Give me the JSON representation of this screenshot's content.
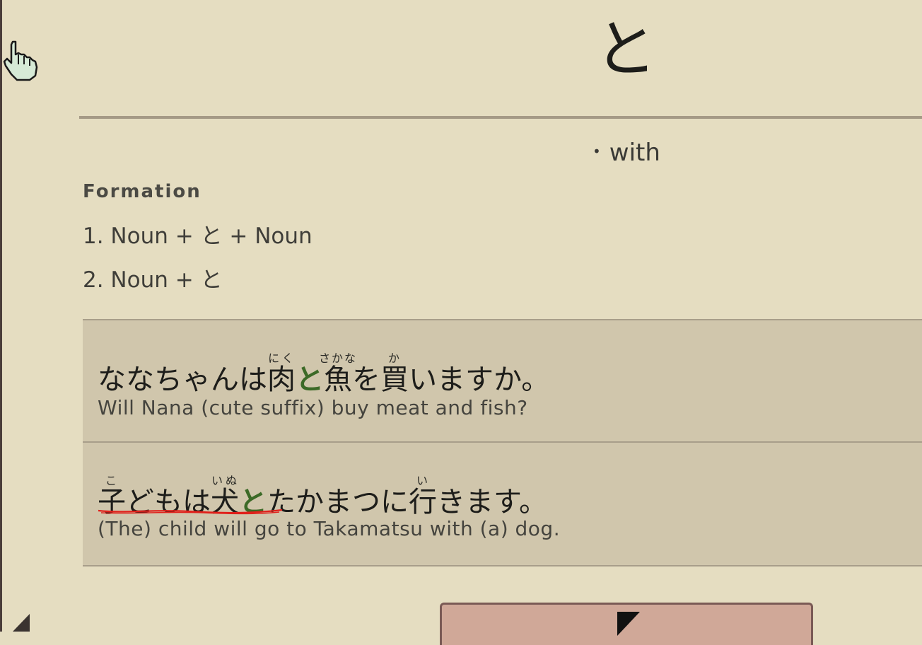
{
  "grammar": {
    "title": "と",
    "meaning": "with"
  },
  "formation": {
    "heading": "Formation",
    "items": [
      "1. Noun + と + Noun",
      "2. Noun + と"
    ]
  },
  "examples": [
    {
      "jp": {
        "pre": "ななちゃんは",
        "k1": "肉",
        "k1_ruby": "にく",
        "particle": "と",
        "k2": "魚",
        "k2_ruby": "さかな",
        "mid": "を",
        "k3": "買",
        "k3_ruby": "か",
        "post": "いますか。"
      },
      "en": "Will Nana (cute suffix) buy meat and fish?"
    },
    {
      "jp": {
        "k1": "子",
        "k1_ruby": "こ",
        "mid1": "どもは",
        "k2": "犬",
        "k2_ruby": "いぬ",
        "particle": "と",
        "mid2": "たかまつに",
        "k3": "行",
        "k3_ruby": "い",
        "post": "きます。"
      },
      "en": "(The) child will go to Takamatsu with (a) dog."
    }
  ],
  "colors": {
    "background": "#e5ddc1",
    "example_bg": "#d0c6ac",
    "particle_highlight": "#3c6a27",
    "button_bg": "#d0a898",
    "squiggle": "#e0201a"
  },
  "icons": [
    "hand-cursor-icon",
    "pointer-cursor-icon",
    "corner-triangle-icon"
  ]
}
